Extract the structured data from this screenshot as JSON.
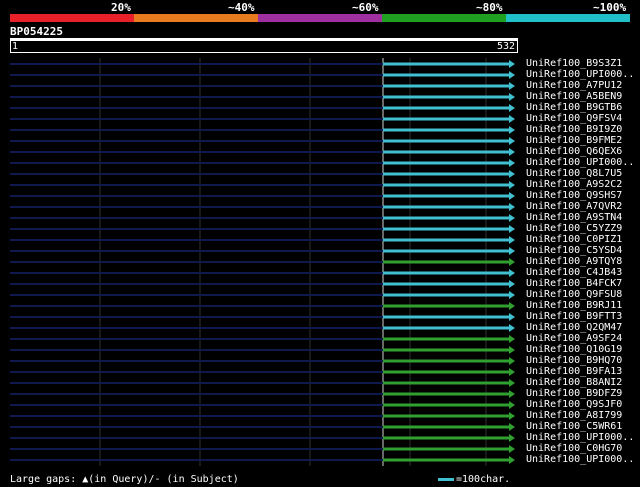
{
  "query": {
    "name": "BP054225",
    "start": "1",
    "end": "532"
  },
  "scale": {
    "segments": [
      {
        "color": "#e8202a",
        "label": "20%"
      },
      {
        "color": "#e87a20",
        "label": "~40%"
      },
      {
        "color": "#a030a0",
        "label": "~60%"
      },
      {
        "color": "#20a020",
        "label": "~80%"
      },
      {
        "color": "#20c0c8",
        "label": "~100%"
      }
    ]
  },
  "colors": {
    "cyan": "#40c0d0",
    "green": "#30a030",
    "track": "#101850",
    "grid": "#303030"
  },
  "hits": [
    {
      "label": "UniRef100_B9S3Z1",
      "color": "cyan"
    },
    {
      "label": "UniRef100_UPI000..",
      "color": "cyan"
    },
    {
      "label": "UniRef100_A7PU12",
      "color": "cyan"
    },
    {
      "label": "UniRef100_A5BEN9",
      "color": "cyan"
    },
    {
      "label": "UniRef100_B9GTB6",
      "color": "cyan"
    },
    {
      "label": "UniRef100_Q9FSV4",
      "color": "cyan"
    },
    {
      "label": "UniRef100_B9I9Z0",
      "color": "cyan"
    },
    {
      "label": "UniRef100_B9FME2",
      "color": "cyan"
    },
    {
      "label": "UniRef100_Q6QEX6",
      "color": "cyan"
    },
    {
      "label": "UniRef100_UPI000..",
      "color": "cyan"
    },
    {
      "label": "UniRef100_Q8L7U5",
      "color": "cyan"
    },
    {
      "label": "UniRef100_A9S2C2",
      "color": "cyan"
    },
    {
      "label": "UniRef100_Q9SHS7",
      "color": "cyan"
    },
    {
      "label": "UniRef100_A7QVR2",
      "color": "cyan"
    },
    {
      "label": "UniRef100_A9STN4",
      "color": "cyan"
    },
    {
      "label": "UniRef100_C5YZZ9",
      "color": "cyan"
    },
    {
      "label": "UniRef100_C0PIZ1",
      "color": "cyan"
    },
    {
      "label": "UniRef100_C5YSD4",
      "color": "cyan"
    },
    {
      "label": "UniRef100_A9TQY8",
      "color": "green"
    },
    {
      "label": "UniRef100_C4JB43",
      "color": "cyan"
    },
    {
      "label": "UniRef100_B4FCK7",
      "color": "cyan"
    },
    {
      "label": "UniRef100_Q9FSU8",
      "color": "cyan"
    },
    {
      "label": "UniRef100_B9RJ11",
      "color": "green"
    },
    {
      "label": "UniRef100_B9FTT3",
      "color": "cyan"
    },
    {
      "label": "UniRef100_Q2QM47",
      "color": "cyan"
    },
    {
      "label": "UniRef100_A9SF24",
      "color": "green"
    },
    {
      "label": "UniRef100_Q10G19",
      "color": "green"
    },
    {
      "label": "UniRef100_B9HQ70",
      "color": "green"
    },
    {
      "label": "UniRef100_B9FA13",
      "color": "green"
    },
    {
      "label": "UniRef100_B8ANI2",
      "color": "green"
    },
    {
      "label": "UniRef100_B9DFZ9",
      "color": "green"
    },
    {
      "label": "UniRef100_Q9SJF0",
      "color": "green"
    },
    {
      "label": "UniRef100_A8I799",
      "color": "green"
    },
    {
      "label": "UniRef100_C5WR61",
      "color": "green"
    },
    {
      "label": "UniRef100_UPI000..",
      "color": "green"
    },
    {
      "label": "UniRef100_C0HG70",
      "color": "green"
    },
    {
      "label": "UniRef100_UPI000..",
      "color": "green"
    }
  ],
  "legend": {
    "gaps": "Large gaps: ▲(in Query)/- (in Subject)",
    "scale": "=100char."
  }
}
